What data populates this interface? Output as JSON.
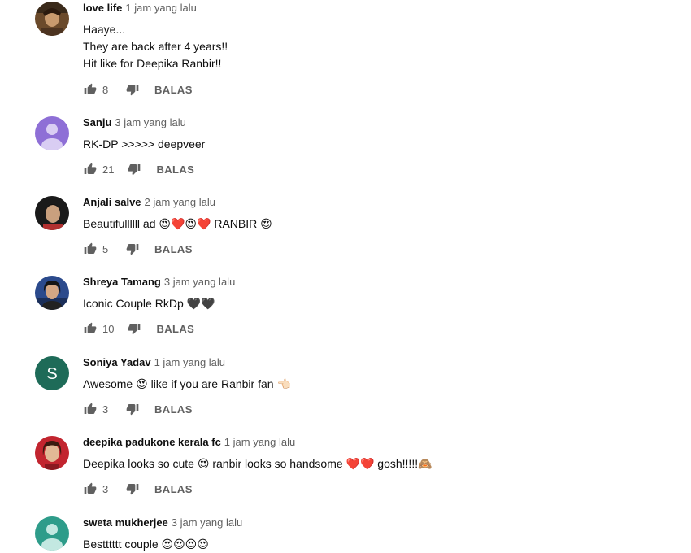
{
  "reply_label": "BALAS",
  "comments": [
    {
      "author": "love life",
      "time": "1 jam yang lalu",
      "lines": [
        "Haaye...",
        "They are back after 4 years!!",
        "Hit like for Deepika Ranbir!!"
      ],
      "likes": "8",
      "avatar": "photo-avatar"
    },
    {
      "author": "Sanju",
      "time": "3 jam yang lalu",
      "lines": [
        "RK-DP >>>>> deepveer"
      ],
      "likes": "21",
      "avatar": "default-avatar",
      "avatar_color": "#8e6fd6"
    },
    {
      "author": "Anjali salve",
      "time": "2 jam yang lalu",
      "lines": [
        "Beautifullllll ad 😍❤️😍❤️ RANBIR 😍"
      ],
      "likes": "5",
      "avatar": "photo-avatar"
    },
    {
      "author": "Shreya Tamang",
      "time": "3 jam yang lalu",
      "lines": [
        "Iconic Couple RkDp 🖤🖤"
      ],
      "likes": "10",
      "avatar": "photo-avatar"
    },
    {
      "author": "Soniya Yadav",
      "time": "1 jam yang lalu",
      "lines": [
        "Awesome 😍 like if you are Ranbir fan 👈🏻"
      ],
      "likes": "3",
      "avatar": "letter-avatar",
      "avatar_letter": "S",
      "avatar_color": "#1e6b58"
    },
    {
      "author": "deepika padukone kerala fc",
      "time": "1 jam yang lalu",
      "lines": [
        "Deepika looks so cute 😍 ranbir looks so handsome ❤️❤️ gosh!!!!!🙈"
      ],
      "likes": "3",
      "avatar": "photo-avatar"
    },
    {
      "author": "sweta mukherjee",
      "time": "3 jam yang lalu",
      "lines": [
        "Bestttttt couple 😍😍😍😍"
      ],
      "likes": "",
      "avatar": "default-avatar",
      "avatar_color": "#2e9c8a"
    }
  ]
}
